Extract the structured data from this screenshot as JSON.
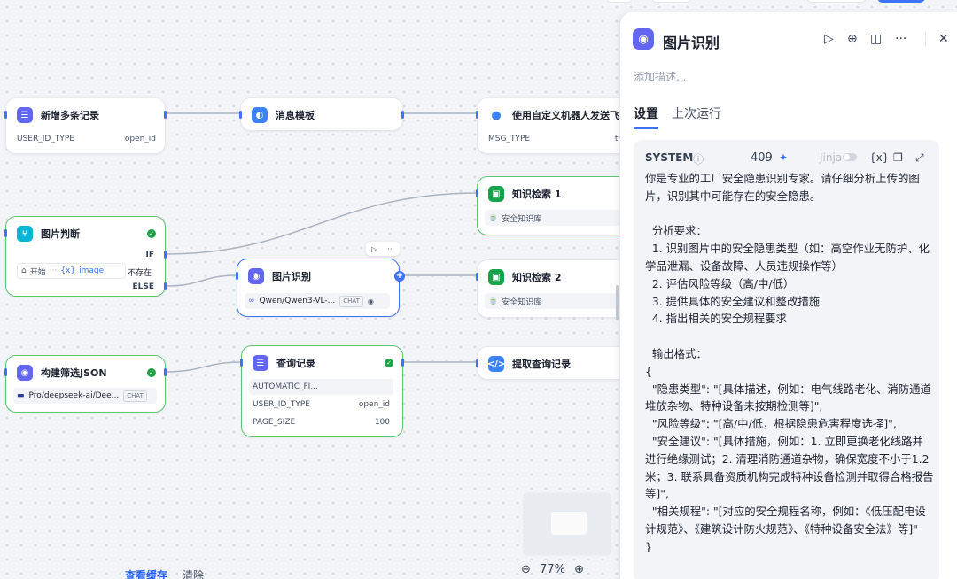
{
  "canvas": {
    "nodes": {
      "add_records": {
        "title": "新增多条记录",
        "row_key": "USER_ID_TYPE",
        "row_val": "open_id"
      },
      "msg_template": {
        "title": "消息模板"
      },
      "feishu": {
        "title": "使用自定义机器人发送飞书消",
        "row_key": "MSG_TYPE",
        "row_val": "te"
      },
      "kb1": {
        "title": "知识检索 1",
        "kb": "安全知识库"
      },
      "img_judge": {
        "title": "图片判断",
        "if_label": "IF",
        "cond_src": "开始",
        "cond_dots": "···",
        "cond_var": "image",
        "cond_op": "不存在",
        "else_label": "ELSE"
      },
      "img_recog": {
        "title": "图片识别",
        "model": "Qwen/Qwen3-VL-...",
        "tag": "CHAT",
        "toolbar_run": "▷",
        "toolbar_more": "···"
      },
      "kb2": {
        "title": "知识检索 2",
        "kb": "安全知识库"
      },
      "build_json": {
        "title": "构建筛选JSON",
        "model": "Pro/deepseek-ai/Dee...",
        "tag": "CHAT"
      },
      "query": {
        "title": "查询记录",
        "row1": "AUTOMATIC_FI...",
        "row2_key": "USER_ID_TYPE",
        "row2_val": "open_id",
        "row3_key": "PAGE_SIZE",
        "row3_val": "100"
      },
      "extract": {
        "title": "提取查询记录"
      }
    },
    "bottom": {
      "view_cache": "查看缓存",
      "clear": "清除"
    },
    "zoom": {
      "level": "77%"
    }
  },
  "panel": {
    "title": "图片识别",
    "description_placeholder": "添加描述...",
    "tabs": [
      "设置",
      "上次运行"
    ],
    "system": {
      "label": "SYSTEM",
      "token_count": "409",
      "jinja_label": "Jinja",
      "var_label": "{x}",
      "prompt": "你是专业的工厂安全隐患识别专家。请仔细分析上传的图片，识别其中可能存在的安全隐患。\n\n  分析要求：\n  1. 识别图片中的安全隐患类型（如：高空作业无防护、化学品泄漏、设备故障、人员违规操作等）\n  2. 评估风险等级（高/中/低）\n  3. 提供具体的安全建议和整改措施\n  4. 指出相关的安全规程要求\n\n  输出格式：\n{\n  \"隐患类型\": \"[具体描述，例如：电气线路老化、消防通道堆放杂物、特种设备未按期检测等]\",\n  \"风险等级\": \"[高/中/低，根据隐患危害程度选择]\",\n  \"安全建议\": \"[具体措施，例如：1. 立即更换老化线路并进行绝缘测试；2. 清理消防通道杂物，确保宽度不小于1.2米；3. 联系具备资质机构完成特种设备检测并取得合格报告等]\",\n  \"相关规程\": \"[对应的安全规程名称，例如：《低压配电设计规范》、《建筑设计防火规范》、《特种设备安全法》等]\"\n}"
    }
  },
  "colors": {
    "accent": "#3f73f6",
    "success": "#1fa146",
    "node_green": "#5cc472"
  }
}
